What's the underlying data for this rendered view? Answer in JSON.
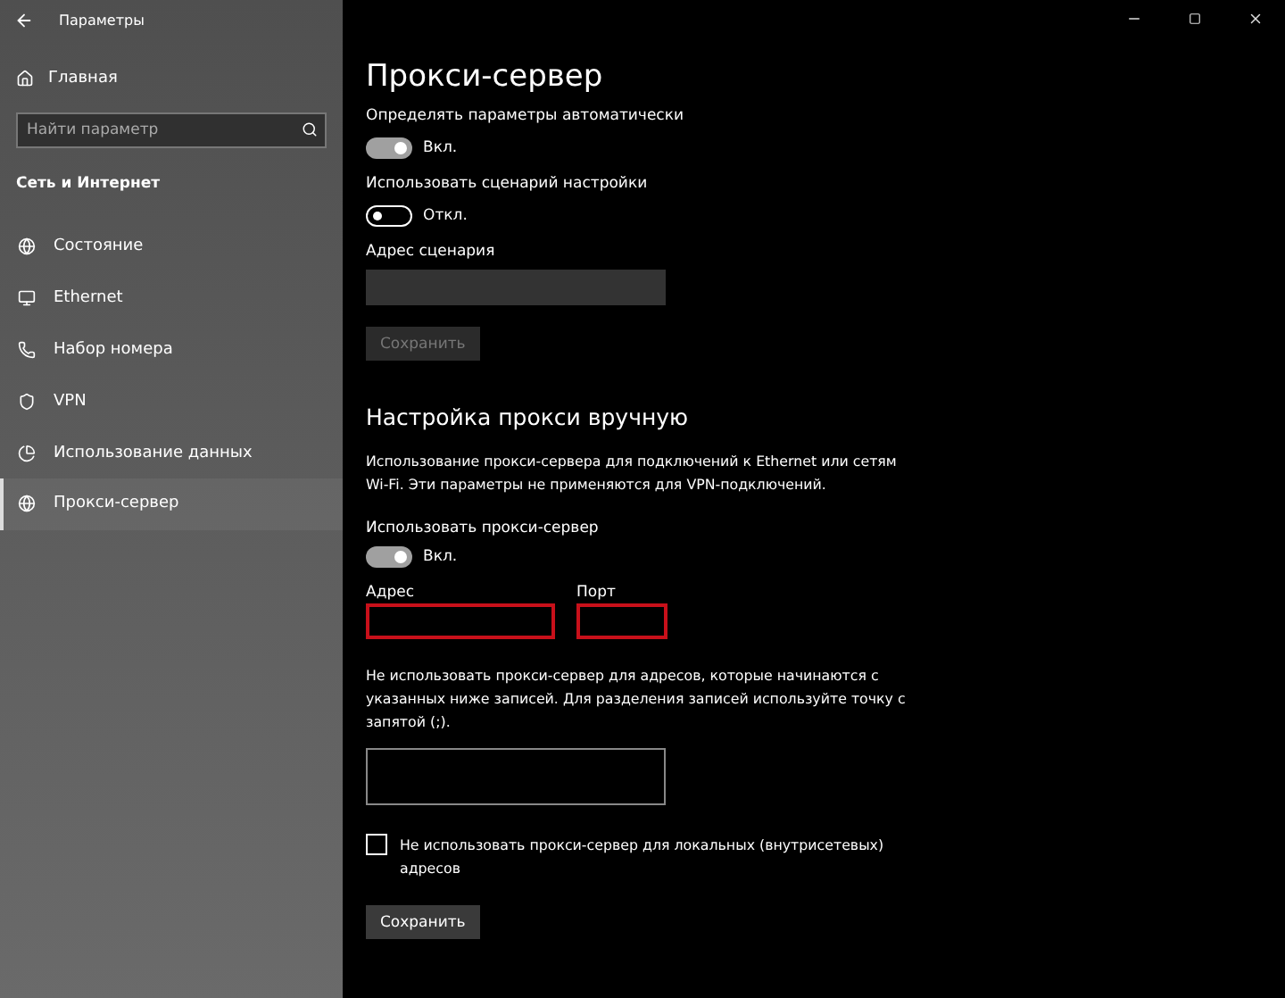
{
  "window": {
    "title": "Параметры"
  },
  "sidebar": {
    "home": "Главная",
    "search": {
      "placeholder": "Найти параметр"
    },
    "section": "Сеть и Интернет",
    "items": [
      {
        "label": "Состояние",
        "selected": false
      },
      {
        "label": "Ethernet",
        "selected": false
      },
      {
        "label": "Набор номера",
        "selected": false
      },
      {
        "label": "VPN",
        "selected": false
      },
      {
        "label": "Использование данных",
        "selected": false
      },
      {
        "label": "Прокси-сервер",
        "selected": true
      }
    ]
  },
  "page": {
    "title": "Прокси-сервер",
    "auto": {
      "label": "Определять параметры автоматически",
      "toggle": {
        "on": true,
        "text": "Вкл."
      }
    },
    "script": {
      "label": "Использовать сценарий настройки",
      "toggle": {
        "on": false,
        "text": "Откл."
      },
      "address_label": "Адрес сценария",
      "address_disabled": true,
      "save": {
        "label": "Сохранить",
        "disabled": true
      }
    },
    "manual": {
      "heading": "Настройка прокси вручную",
      "description": "Использование прокси-сервера для подключений к Ethernet или сетям Wi-Fi. Эти параметры не применяются для VPN-подключений.",
      "use_label": "Использовать прокси-сервер",
      "toggle": {
        "on": true,
        "text": "Вкл."
      },
      "address": {
        "label": "Адрес",
        "highlighted": true
      },
      "port": {
        "label": "Порт",
        "highlighted": true
      },
      "exceptions_text": "Не использовать прокси-сервер для адресов, которые начинаются с указанных ниже записей. Для разделения записей используйте точку с запятой (;).",
      "local": {
        "label": "Не использовать прокси-сервер для локальных (внутрисетевых) адресов",
        "checked": false
      },
      "save": {
        "label": "Сохранить",
        "disabled": false
      }
    }
  }
}
